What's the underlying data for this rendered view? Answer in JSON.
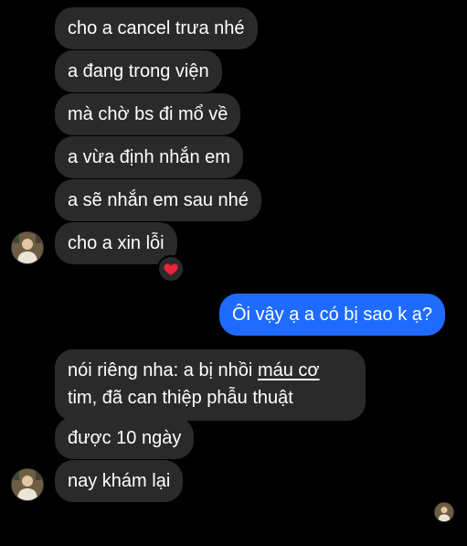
{
  "conversation": {
    "messages": [
      {
        "id": "m1",
        "text": "cho a cancel trưa nhé",
        "direction": "incoming"
      },
      {
        "id": "m2",
        "text": "a đang trong viện",
        "direction": "incoming"
      },
      {
        "id": "m3",
        "text": "mà chờ bs đi mổ về",
        "direction": "incoming"
      },
      {
        "id": "m4",
        "text": "a vừa định nhắn em",
        "direction": "incoming"
      },
      {
        "id": "m5",
        "text": "a sẽ nhắn em sau nhé",
        "direction": "incoming"
      },
      {
        "id": "m6",
        "text": "cho a xin lỗi",
        "direction": "incoming",
        "reaction": "heart"
      },
      {
        "id": "m7",
        "text": "Ôi vậy ạ a có bị sao k ạ?",
        "direction": "outgoing"
      },
      {
        "id": "m8",
        "text_before": "nói riêng nha: a bị nhồi ",
        "link_text": "máu cơ",
        "text_after": "tim, đã can thiệp phẫu thuật",
        "direction": "incoming"
      },
      {
        "id": "m9",
        "text": "được 10 ngày",
        "direction": "incoming"
      },
      {
        "id": "m10",
        "text": "nay khám lại",
        "direction": "incoming"
      }
    ]
  },
  "colors": {
    "background": "#000000",
    "incoming_bubble": "#2a2a2b",
    "outgoing_bubble": "#1f6bff",
    "text": "#ffffff",
    "reaction_heart": "#e8253a"
  },
  "icons": {
    "reaction": "red-heart-icon",
    "avatar": "contact-avatar"
  }
}
